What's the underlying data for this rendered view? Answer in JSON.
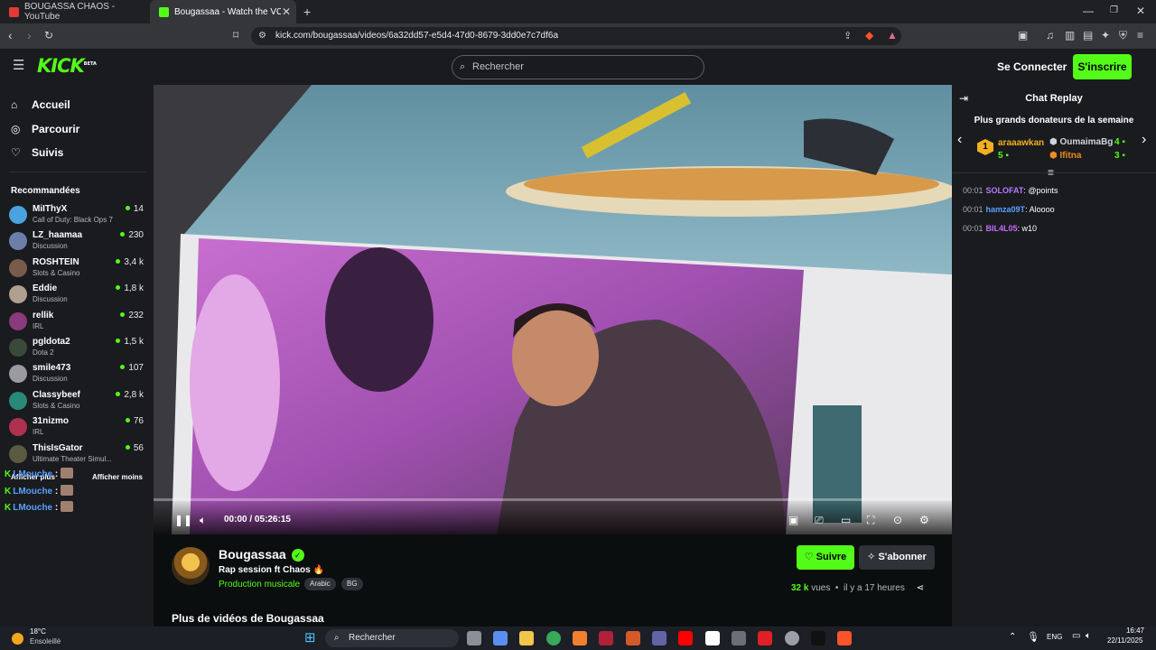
{
  "browser": {
    "tabs": [
      {
        "title": "BOUGASSA CHAOS - YouTube",
        "active": false
      },
      {
        "title": "Bougassaa - Watch the VOD on",
        "active": true
      }
    ],
    "url": "kick.com/bougassaa/videos/6a32dd57-e5d4-47d0-8679-3dd0e7c7df6a"
  },
  "header": {
    "logo": "KICK",
    "logo_sup": "BETA",
    "search_placeholder": "Rechercher",
    "connect_label": "Se Connecter",
    "signup_label": "S'inscrire"
  },
  "sidebar": {
    "nav": [
      {
        "label": "Accueil",
        "icon": "home-icon"
      },
      {
        "label": "Parcourir",
        "icon": "compass-icon"
      },
      {
        "label": "Suivis",
        "icon": "heart-icon"
      }
    ],
    "recommended_title": "Recommandées",
    "channels": [
      {
        "name": "MiIThyX",
        "category": "Call of Duty: Black Ops 7",
        "viewers": "14",
        "color": "#4aa3df"
      },
      {
        "name": "LZ_haamaa",
        "category": "Discussion",
        "viewers": "230",
        "color": "#6b7fa8"
      },
      {
        "name": "ROSHTEIN",
        "category": "Slots & Casino",
        "viewers": "3,4 k",
        "color": "#7a5a4a"
      },
      {
        "name": "Eddie",
        "category": "Discussion",
        "viewers": "1,8 k",
        "color": "#b0a090"
      },
      {
        "name": "rellik",
        "category": "IRL",
        "viewers": "232",
        "color": "#8a3a7a"
      },
      {
        "name": "pgldota2",
        "category": "Dota 2",
        "viewers": "1,5 k",
        "color": "#3a4a3a"
      },
      {
        "name": "smile473",
        "category": "Discussion",
        "viewers": "107",
        "color": "#9a9aa0"
      },
      {
        "name": "Classybeef",
        "category": "Slots & Casino",
        "viewers": "2,8 k",
        "color": "#2a8a7a"
      },
      {
        "name": "31nizmo",
        "category": "IRL",
        "viewers": "76",
        "color": "#b03050"
      },
      {
        "name": "ThisIsGator",
        "category": "Ultimate Theater Simul...",
        "viewers": "56",
        "color": "#5a5a40"
      }
    ],
    "show_more": "Afficher plus",
    "show_less": "Afficher moins",
    "overlay_user": "LMouche",
    "overlay_sep": ":"
  },
  "player": {
    "time": "00:00 / 05:26:15",
    "progress": 0
  },
  "video_info": {
    "channel": "Bougassaa",
    "title": "Rap session ft Chaos 🔥",
    "category": "Production musicale",
    "tags": [
      "Arabic",
      "BG"
    ],
    "follow_label": "Suivre",
    "subscribe_label": "S'abonner",
    "views_count": "32 k",
    "views_word": "vues",
    "age": "il y a 17 heures",
    "more_title": "Plus de vidéos de Bougassaa"
  },
  "chat": {
    "title": "Chat Replay",
    "donors_title": "Plus grands donateurs de la semaine",
    "donors": [
      {
        "rank": "1",
        "name": "araaawkan",
        "amount": "5"
      },
      {
        "name": "OumaimaBg",
        "amount": "4"
      },
      {
        "name": "Ifitna",
        "amount": "3"
      }
    ],
    "messages": [
      {
        "time": "00:01",
        "user": "SOLOFAT",
        "text": ": @points",
        "color": "#b57bff"
      },
      {
        "time": "00:01",
        "user": "hamza09T",
        "text": ": Aloooo",
        "color": "#5aa0ff"
      },
      {
        "time": "00:01",
        "user": "BIL4L05",
        "text": ": w10",
        "color": "#c86bff"
      }
    ]
  },
  "taskbar": {
    "weather_temp": "18°C",
    "weather_desc": "Ensoleillé",
    "search_placeholder": "Rechercher",
    "lang": "ENG",
    "clock_time": "16:47",
    "clock_date": "22/11/2025"
  }
}
